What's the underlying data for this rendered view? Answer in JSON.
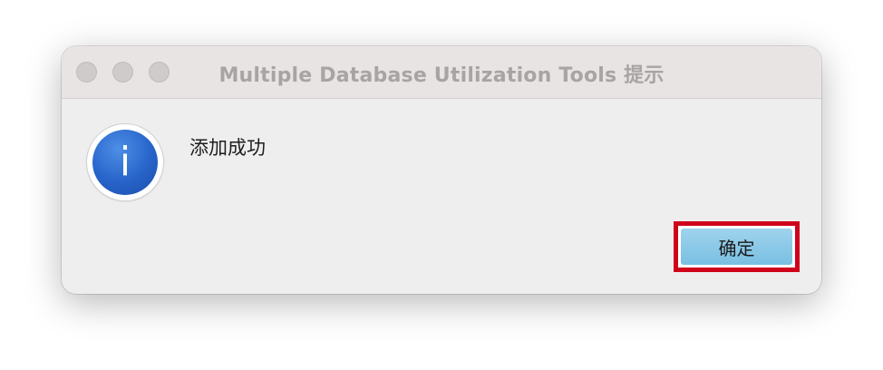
{
  "window": {
    "title": "Multiple Database Utilization Tools 提示"
  },
  "dialog": {
    "message": "添加成功",
    "icon": "info-icon",
    "icon_glyph": "i",
    "ok_label": "确定"
  },
  "colors": {
    "ok_button": "#8ccbe8",
    "highlight_border": "#d0021b",
    "info_icon": "#2763c9"
  }
}
